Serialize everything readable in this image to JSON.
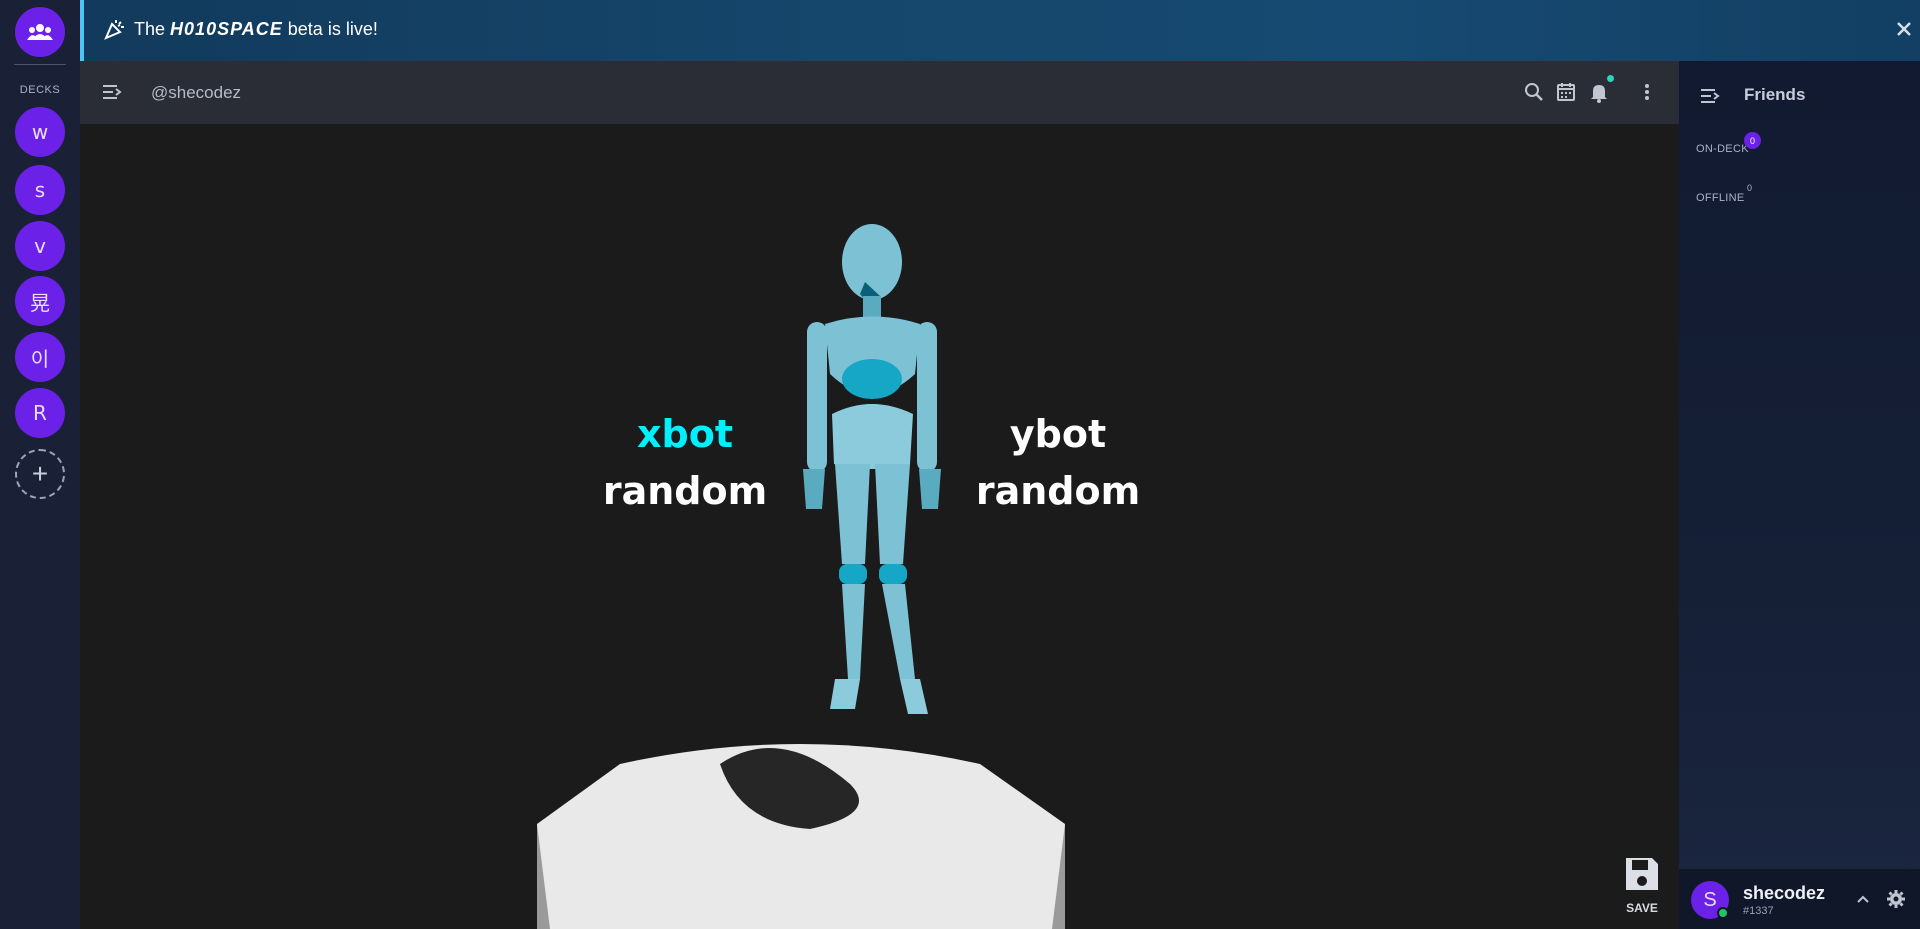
{
  "rail": {
    "home_icon": "people-icon",
    "section_label": "DECKS",
    "decks": [
      {
        "label": "w"
      },
      {
        "label": "s"
      },
      {
        "label": "v"
      },
      {
        "label": "晃"
      },
      {
        "label": "이"
      },
      {
        "label": "R"
      }
    ],
    "add_icon": "plus-icon"
  },
  "banner": {
    "prefix": "The",
    "brand": "H010SPACE",
    "suffix": "beta is live!",
    "icon": "party-popper-icon",
    "close_icon": "close-icon"
  },
  "topbar": {
    "handle": "@shecodez",
    "icons": [
      "menu-collapse-icon",
      "search-icon",
      "calendar-icon",
      "bell-icon",
      "more-vertical-icon"
    ]
  },
  "stage": {
    "left_bot": {
      "name": "xbot",
      "mode": "random",
      "name_color": "#00f0ff"
    },
    "right_bot": {
      "name": "ybot",
      "mode": "random",
      "name_color": "#ffffff"
    },
    "save_label": "SAVE",
    "model_color": "#6fb6c9",
    "accent_color": "#16a7c6"
  },
  "friends": {
    "title": "Friends",
    "sections": [
      {
        "label": "ON-DECK",
        "count": "0"
      },
      {
        "label": "OFFLINE",
        "count": "0"
      }
    ]
  },
  "user": {
    "initial": "S",
    "name": "shecodez",
    "tag": "#1337",
    "status_color": "#22c55e"
  },
  "colors": {
    "accent": "#6b21e8",
    "banner_border": "#4fc3f7"
  }
}
